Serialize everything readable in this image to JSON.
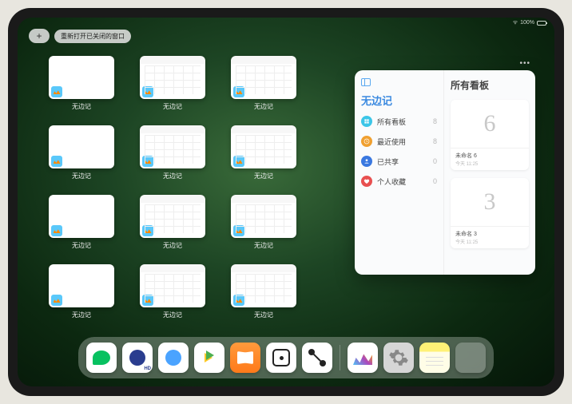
{
  "status": {
    "battery_text": "100%"
  },
  "top": {
    "plus": "+",
    "reopen_label": "重新打开已关闭的窗口"
  },
  "windows": [
    {
      "label": "无边记",
      "variant": "blank"
    },
    {
      "label": "无边记",
      "variant": "cal"
    },
    {
      "label": "无边记",
      "variant": "cal"
    },
    {
      "label": "无边记",
      "variant": "blank"
    },
    {
      "label": "无边记",
      "variant": "cal"
    },
    {
      "label": "无边记",
      "variant": "cal"
    },
    {
      "label": "无边记",
      "variant": "blank"
    },
    {
      "label": "无边记",
      "variant": "cal"
    },
    {
      "label": "无边记",
      "variant": "cal"
    },
    {
      "label": "无边记",
      "variant": "blank"
    },
    {
      "label": "无边记",
      "variant": "cal"
    },
    {
      "label": "无边记",
      "variant": "cal"
    }
  ],
  "panel": {
    "left_title": "无边记",
    "categories": [
      {
        "label": "所有看板",
        "count": "8",
        "color": "#3cc6e8"
      },
      {
        "label": "最近使用",
        "count": "8",
        "color": "#f0a030"
      },
      {
        "label": "已共享",
        "count": "0",
        "color": "#3a78e0"
      },
      {
        "label": "个人收藏",
        "count": "0",
        "color": "#e85050"
      }
    ],
    "right_title": "所有看板",
    "boards": [
      {
        "glyph": "6",
        "name": "未命名 6",
        "sub": "今天 11:25"
      },
      {
        "glyph": "3",
        "name": "未命名 3",
        "sub": "今天 11:25"
      }
    ]
  },
  "dock": {
    "items": [
      {
        "name": "wechat"
      },
      {
        "name": "quark-hd"
      },
      {
        "name": "quark"
      },
      {
        "name": "play"
      },
      {
        "name": "books"
      },
      {
        "name": "dice"
      },
      {
        "name": "connect"
      }
    ],
    "recent": [
      {
        "name": "freeform"
      },
      {
        "name": "settings"
      },
      {
        "name": "notes"
      },
      {
        "name": "folder"
      }
    ]
  }
}
